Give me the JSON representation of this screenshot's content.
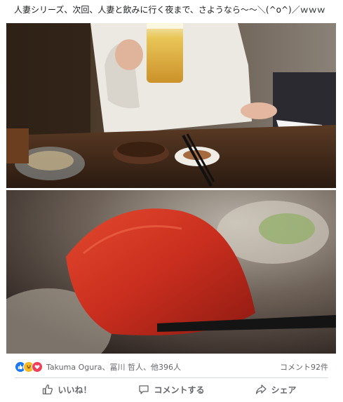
{
  "post": {
    "text": "人妻シリーズ、次回、人妻と飲みに行く夜まで、さようなら〜〜＼(^o^)／ｗｗｗ"
  },
  "photos": [
    {
      "icon": "photo-dinner-table-beer"
    },
    {
      "icon": "photo-tuna-sashimi-chopsticks"
    }
  ],
  "reactions": {
    "icons": [
      "like-reaction-icon",
      "haha-reaction-icon",
      "love-reaction-icon"
    ],
    "names": "Takuma Ogura、冨川 哲人、他396人",
    "comments": "コメント92件"
  },
  "actions": {
    "like": "いいね！",
    "comment": "コメントする",
    "share": "シェア"
  },
  "colors": {
    "accent": "#1877f2",
    "muted_text": "#65676b",
    "divider": "#dadde1"
  }
}
